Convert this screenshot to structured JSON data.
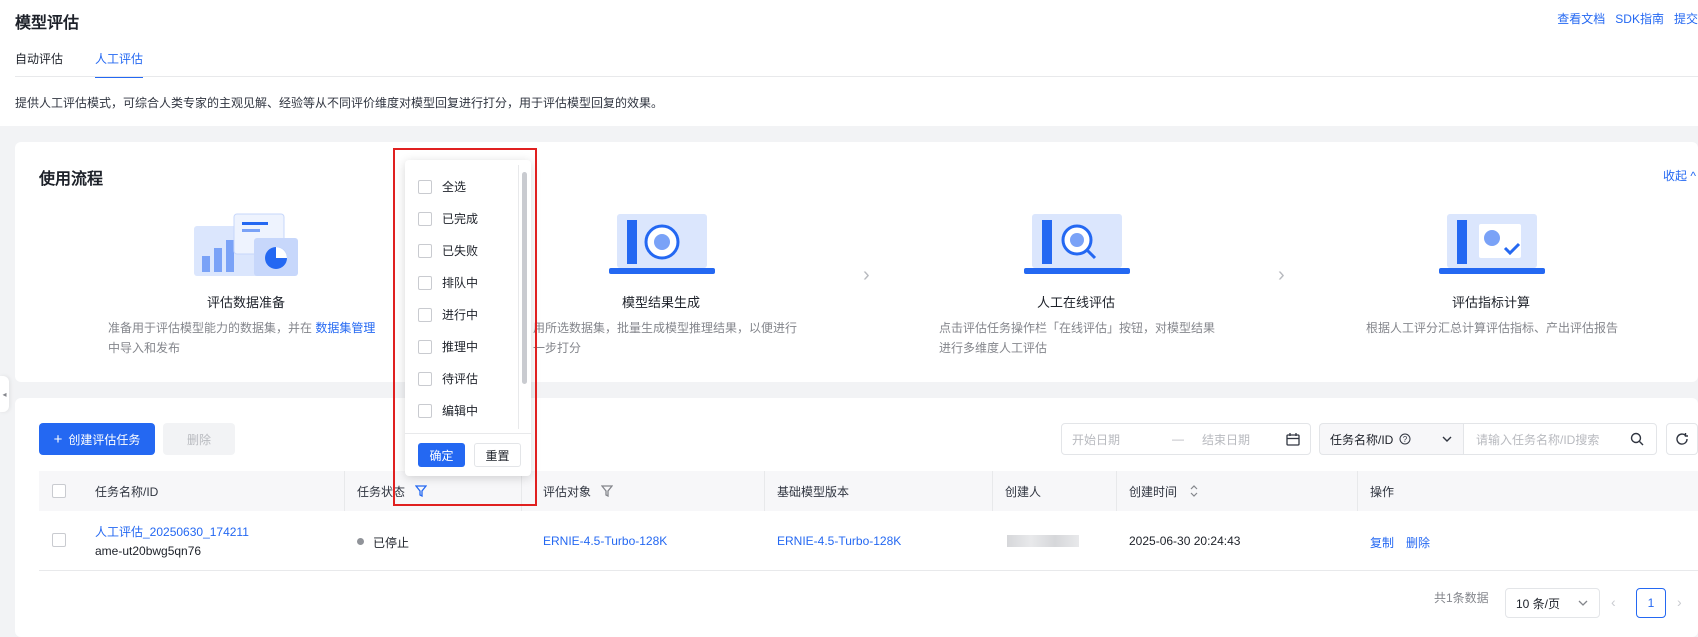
{
  "header": {
    "title": "模型评估",
    "links": [
      "查看文档",
      "SDK指南",
      "提交"
    ],
    "tabs": [
      {
        "label": "自动评估",
        "active": false
      },
      {
        "label": "人工评估",
        "active": true
      }
    ],
    "description": "提供人工评估模式，可综合人类专家的主观见解、经验等从不同评价维度对模型回复进行打分，用于评估模型回复的效果。"
  },
  "workflow": {
    "title": "使用流程",
    "collapse_label": "收起",
    "steps": [
      {
        "title": "评估数据准备",
        "desc": "准备用于评估模型能力的数据集，并在",
        "link": "数据集管理",
        "desc2": "中导入和发布"
      },
      {
        "title": "模型结果生成",
        "desc": "用所选数据集，批量生成模型推理结果，以便进行",
        "desc2": "一步打分"
      },
      {
        "title": "人工在线评估",
        "desc": "点击评估任务操作栏「在线评估」按钮，对模型结果",
        "desc2": "进行多维度人工评估"
      },
      {
        "title": "评估指标计算",
        "desc": "根据人工评分汇总计算评估指标、产出评估报告"
      }
    ]
  },
  "toolbar": {
    "create_label": "创建评估任务",
    "delete_label": "删除",
    "start_date_placeholder": "开始日期",
    "date_sep": "—",
    "end_date_placeholder": "结束日期",
    "search_field": "任务名称/ID",
    "search_placeholder": "请输入任务名称/ID搜索"
  },
  "table": {
    "columns": [
      "任务名称/ID",
      "任务状态",
      "评估对象",
      "基础模型版本",
      "创建人",
      "创建时间",
      "操作"
    ],
    "rows": [
      {
        "name": "人工评估_20250630_174211",
        "id": "ame-ut20bwg5qn76",
        "status": "已停止",
        "target": "ERNIE-4.5-Turbo-128K",
        "base_model": "ERNIE-4.5-Turbo-128K",
        "created_at": "2025-06-30 20:24:43",
        "actions": [
          "复制",
          "删除"
        ]
      }
    ]
  },
  "pagination": {
    "total": "共1条数据",
    "page_size": "10 条/页",
    "current_page": "1"
  },
  "status_filter": {
    "options": [
      "全选",
      "已完成",
      "已失败",
      "排队中",
      "进行中",
      "推理中",
      "待评估",
      "编辑中"
    ],
    "confirm": "确定",
    "reset": "重置"
  },
  "colors": {
    "accent": "#2468f2",
    "highlight": "#e02020"
  }
}
